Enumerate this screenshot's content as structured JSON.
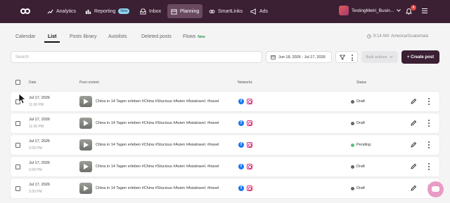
{
  "nav": {
    "items": [
      {
        "label": "Analytics",
        "icon": "chart-icon"
      },
      {
        "label": "Reporting",
        "icon": "report-icon",
        "badge": "New"
      },
      {
        "label": "Inbox",
        "icon": "inbox-icon"
      },
      {
        "label": "Planning",
        "icon": "calendar-icon",
        "active": true
      },
      {
        "label": "SmartLinks",
        "icon": "link-icon"
      },
      {
        "label": "Ads",
        "icon": "megaphone-icon"
      }
    ],
    "account_name": "TestingMetri_Busin...",
    "notifications_count": "4"
  },
  "tabs": [
    {
      "label": "Calendar"
    },
    {
      "label": "List",
      "active": true
    },
    {
      "label": "Posts library"
    },
    {
      "label": "Autolists"
    },
    {
      "label": "Deleted posts"
    },
    {
      "label": "Flows",
      "badge": "New"
    }
  ],
  "timezone": {
    "time": "9:14 AM",
    "zone": "America/Guatemala"
  },
  "toolbar": {
    "search_placeholder": "Search",
    "date_range": "Jun 18, 2026 - Jul 17, 2026",
    "bulk_actions": "Bulk actions",
    "create_post": "+ Create post"
  },
  "table": {
    "columns": {
      "date": "Date",
      "content": "Post content",
      "networks": "Networks",
      "status": "Status"
    },
    "rows": [
      {
        "date": "Jul 17, 2026",
        "time": "11:00 PM",
        "content": "China in 14 Tagen erleben #China #Stucious #Asien #Asiatravel. #travel",
        "status": "Draft",
        "status_color": "#666666"
      },
      {
        "date": "Jul 17, 2026",
        "time": "11:00 PM",
        "content": "China in 14 Tagen erleben #China #Stucious #Asien #Asiatravel. #travel",
        "status": "Draft",
        "status_color": "#666666"
      },
      {
        "date": "Jul 17, 2026",
        "time": "3:30 PM",
        "content": "China in 14 Tagen erleben #China #Stucious #Asien #Asiatravel. #travel",
        "status": "Pending",
        "status_color": "#5bbf7a"
      },
      {
        "date": "Jul 17, 2026",
        "time": "3:30 PM",
        "content": "China in 14 Tagen erleben #China #Stucious #Asien #Asiatravel. #travel",
        "status": "Draft",
        "status_color": "#666666"
      },
      {
        "date": "Jul 17, 2026",
        "time": "3:30 PM",
        "content": "China in 14 Tagen erleben #China #Stucious #Asien #Asiatravel. #travel",
        "status": "Draft",
        "status_color": "#666666"
      }
    ]
  },
  "colors": {
    "brand": "#3b1f33",
    "facebook": "#1877f2",
    "instagram": "#d62976"
  }
}
